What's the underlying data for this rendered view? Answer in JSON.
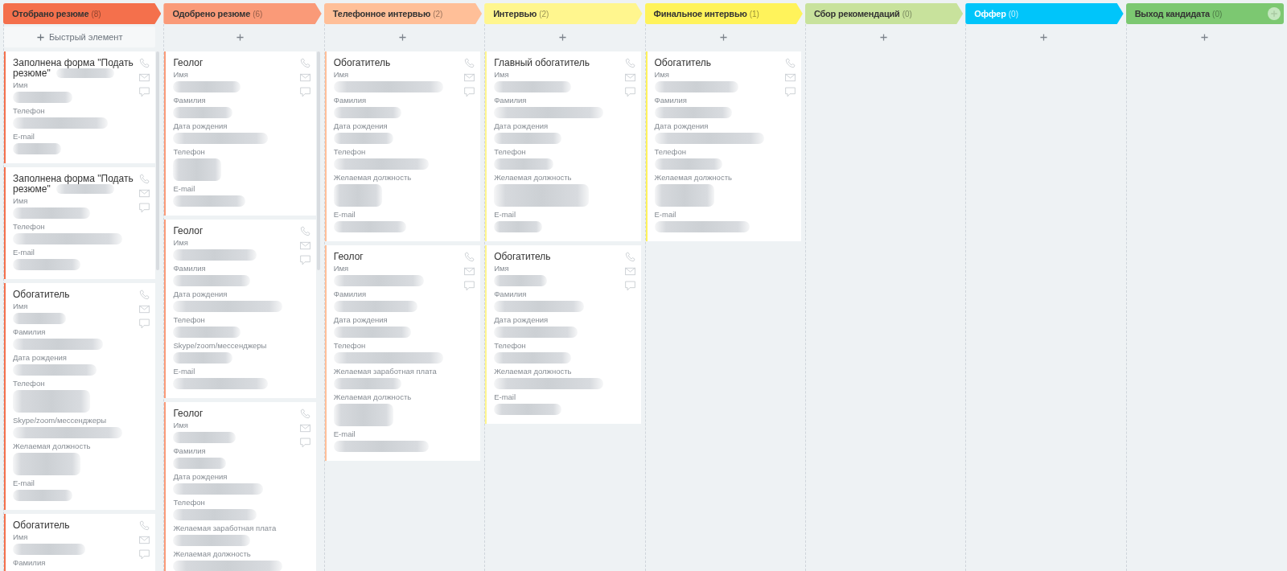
{
  "board": {
    "columns": [
      {
        "title": "Отобрано резюме",
        "count": "(8)",
        "color": "#f4704c",
        "light_text": false,
        "kind": "arrow",
        "scrollbar": true,
        "quick_add_label": "Быстрый элемент",
        "cards": [
          {
            "title": "Заполнена форма \"Подать резюме\"",
            "title_tail_blurred": true,
            "fields": [
              {
                "label": "Имя",
                "blurred": true,
                "wrapped": false
              },
              {
                "label": "Телефон",
                "blurred": true,
                "wrapped": false
              },
              {
                "label": "E-mail",
                "blurred": true,
                "wrapped": false
              }
            ]
          },
          {
            "title": "Заполнена форма \"Подать резюме\"",
            "title_tail_blurred": true,
            "fields": [
              {
                "label": "Имя",
                "blurred": true,
                "wrapped": false
              },
              {
                "label": "Телефон",
                "blurred": true,
                "wrapped": false
              },
              {
                "label": "E-mail",
                "blurred": true,
                "wrapped": false
              }
            ]
          },
          {
            "title": "Обогатитель",
            "title_tail_blurred": false,
            "fields": [
              {
                "label": "Имя",
                "blurred": true,
                "wrapped": false
              },
              {
                "label": "Фамилия",
                "blurred": true,
                "wrapped": false
              },
              {
                "label": "Дата рождения",
                "blurred": true,
                "wrapped": false
              },
              {
                "label": "Телефон",
                "blurred": true,
                "wrapped": true
              },
              {
                "label": "Skype/zoom/мессенджеры",
                "blurred": true,
                "wrapped": false
              },
              {
                "label": "Желаемая должность",
                "blurred": true,
                "wrapped": true
              },
              {
                "label": "E-mail",
                "blurred": true,
                "wrapped": false
              }
            ]
          },
          {
            "title": "Обогатитель",
            "title_tail_blurred": false,
            "fields": [
              {
                "label": "Имя",
                "blurred": true,
                "wrapped": false
              },
              {
                "label": "Фамилия",
                "blurred": false
              }
            ]
          }
        ]
      },
      {
        "title": "Одобрено резюме",
        "count": "(6)",
        "color": "#fa9a78",
        "light_text": false,
        "kind": "arrow",
        "scrollbar": true,
        "cards": [
          {
            "title": "Геолог",
            "title_tail_blurred": false,
            "fields": [
              {
                "label": "Имя",
                "blurred": true,
                "wrapped": false
              },
              {
                "label": "Фамилия",
                "blurred": true,
                "wrapped": false
              },
              {
                "label": "Дата рождения",
                "blurred": true,
                "wrapped": false
              },
              {
                "label": "Телефон",
                "blurred": true,
                "wrapped": true
              },
              {
                "label": "E-mail",
                "blurred": true,
                "wrapped": false
              }
            ]
          },
          {
            "title": "Геолог",
            "title_tail_blurred": false,
            "fields": [
              {
                "label": "Имя",
                "blurred": true,
                "wrapped": false
              },
              {
                "label": "Фамилия",
                "blurred": true,
                "wrapped": false
              },
              {
                "label": "Дата рождения",
                "blurred": true,
                "wrapped": false
              },
              {
                "label": "Телефон",
                "blurred": true,
                "wrapped": false
              },
              {
                "label": "Skype/zoom/мессенджеры",
                "blurred": true,
                "wrapped": false
              },
              {
                "label": "E-mail",
                "blurred": true,
                "wrapped": false
              }
            ]
          },
          {
            "title": "Геолог",
            "title_tail_blurred": false,
            "fields": [
              {
                "label": "Имя",
                "blurred": true,
                "wrapped": false
              },
              {
                "label": "Фамилия",
                "blurred": true,
                "wrapped": false
              },
              {
                "label": "Дата рождения",
                "blurred": true,
                "wrapped": false
              },
              {
                "label": "Телефон",
                "blurred": true,
                "wrapped": false
              },
              {
                "label": "Желаемая заработная плата",
                "blurred": true,
                "wrapped": false
              },
              {
                "label": "Желаемая должность",
                "blurred": true,
                "wrapped": false
              }
            ]
          }
        ]
      },
      {
        "title": "Телефонное интервью",
        "count": "(2)",
        "color": "#ffbf98",
        "light_text": false,
        "kind": "arrow",
        "scrollbar": false,
        "cards": [
          {
            "title": "Обогатитель",
            "title_tail_blurred": false,
            "fields": [
              {
                "label": "Имя",
                "blurred": true,
                "wrapped": false
              },
              {
                "label": "Фамилия",
                "blurred": true,
                "wrapped": false
              },
              {
                "label": "Дата рождения",
                "blurred": true,
                "wrapped": false
              },
              {
                "label": "Телефон",
                "blurred": true,
                "wrapped": false
              },
              {
                "label": "Желаемая должность",
                "blurred": true,
                "wrapped": true
              },
              {
                "label": "E-mail",
                "blurred": true,
                "wrapped": false
              }
            ]
          },
          {
            "title": "Геолог",
            "title_tail_blurred": false,
            "fields": [
              {
                "label": "Имя",
                "blurred": true,
                "wrapped": false
              },
              {
                "label": "Фамилия",
                "blurred": true,
                "wrapped": false
              },
              {
                "label": "Дата рождения",
                "blurred": true,
                "wrapped": false
              },
              {
                "label": "Телефон",
                "blurred": true,
                "wrapped": false
              },
              {
                "label": "Желаемая заработная плата",
                "blurred": true,
                "wrapped": false
              },
              {
                "label": "Желаемая должность",
                "blurred": true,
                "wrapped": true
              },
              {
                "label": "E-mail",
                "blurred": true,
                "wrapped": false
              }
            ]
          }
        ]
      },
      {
        "title": "Интервью",
        "count": "(2)",
        "color": "#fff68e",
        "light_text": false,
        "kind": "arrow",
        "scrollbar": false,
        "cards": [
          {
            "title": "Главный обогатитель",
            "title_tail_blurred": false,
            "fields": [
              {
                "label": "Имя",
                "blurred": true,
                "wrapped": false
              },
              {
                "label": "Фамилия",
                "blurred": true,
                "wrapped": false
              },
              {
                "label": "Дата рождения",
                "blurred": true,
                "wrapped": false
              },
              {
                "label": "Телефон",
                "blurred": true,
                "wrapped": false
              },
              {
                "label": "Желаемая должность",
                "blurred": true,
                "wrapped": true
              },
              {
                "label": "E-mail",
                "blurred": true,
                "wrapped": false
              }
            ]
          },
          {
            "title": "Обогатитель",
            "title_tail_blurred": false,
            "fields": [
              {
                "label": "Имя",
                "blurred": true,
                "wrapped": false
              },
              {
                "label": "Фамилия",
                "blurred": true,
                "wrapped": false
              },
              {
                "label": "Дата рождения",
                "blurred": true,
                "wrapped": false
              },
              {
                "label": "Телефон",
                "blurred": true,
                "wrapped": false
              },
              {
                "label": "Желаемая должность",
                "blurred": true,
                "wrapped": false
              },
              {
                "label": "E-mail",
                "blurred": true,
                "wrapped": false
              }
            ]
          }
        ]
      },
      {
        "title": "Финальное интервью",
        "count": "(1)",
        "color": "#fff35b",
        "light_text": false,
        "kind": "arrow",
        "scrollbar": false,
        "cards": [
          {
            "title": "Обогатитель",
            "title_tail_blurred": false,
            "fields": [
              {
                "label": "Имя",
                "blurred": true,
                "wrapped": false
              },
              {
                "label": "Фамилия",
                "blurred": true,
                "wrapped": false
              },
              {
                "label": "Дата рождения",
                "blurred": true,
                "wrapped": false
              },
              {
                "label": "Телефон",
                "blurred": true,
                "wrapped": false
              },
              {
                "label": "Желаемая должность",
                "blurred": true,
                "wrapped": true
              },
              {
                "label": "E-mail",
                "blurred": true,
                "wrapped": false
              }
            ]
          }
        ]
      },
      {
        "title": "Сбор рекомендаций",
        "count": "(0)",
        "color": "#c8e29c",
        "light_text": false,
        "kind": "arrow",
        "scrollbar": false
      },
      {
        "title": "Оффер",
        "count": "(0)",
        "color": "#00c5fa",
        "light_text": true,
        "kind": "arrow",
        "scrollbar": false
      },
      {
        "title": "Выход кандидата",
        "count": "(0)",
        "color": "#7cc871",
        "light_text": false,
        "kind": "end",
        "scrollbar": false
      }
    ]
  }
}
